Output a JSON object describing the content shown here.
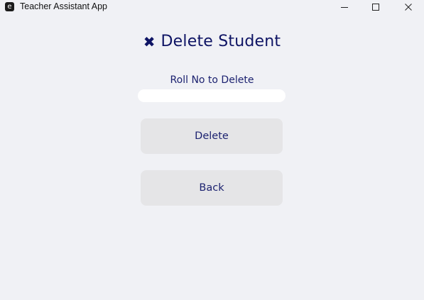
{
  "window": {
    "app_icon_glyph": "e",
    "title": "Teacher Assistant App"
  },
  "header": {
    "icon": "close-x-icon",
    "icon_glyph": "✖",
    "title": "Delete Student"
  },
  "form": {
    "roll_label": "Roll No to Delete",
    "roll_value": "",
    "roll_placeholder": ""
  },
  "buttons": {
    "delete_label": "Delete",
    "back_label": "Back"
  },
  "colors": {
    "background": "#f0f1f5",
    "accent_text": "#0e1464",
    "button_bg": "#e5e5e7",
    "input_bg": "#ffffff"
  }
}
